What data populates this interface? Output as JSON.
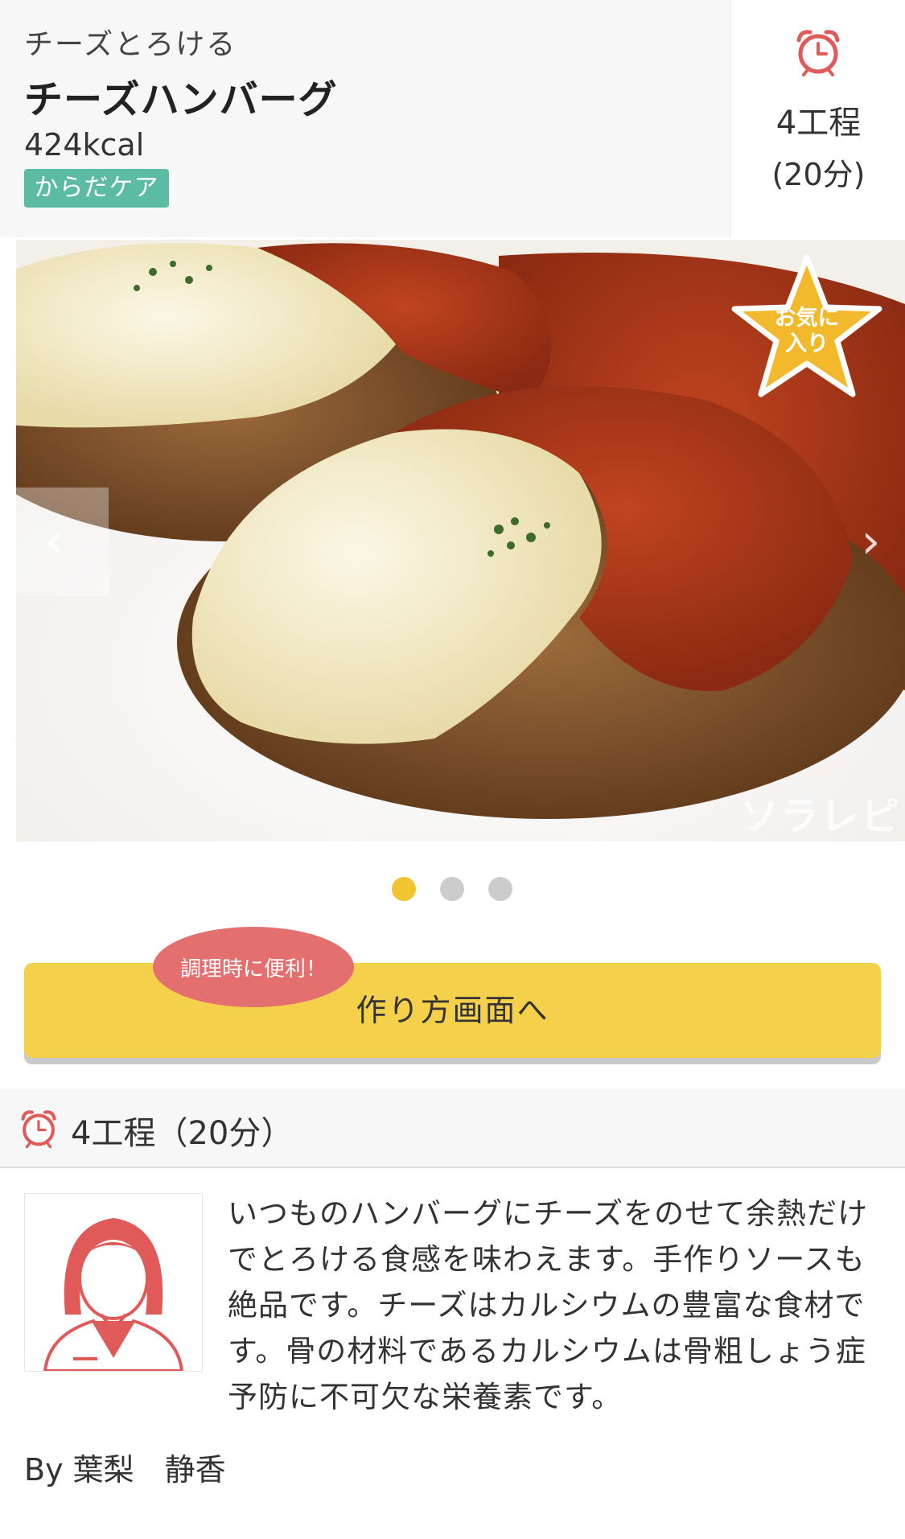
{
  "recipe": {
    "subtitle": "チーズとろける",
    "title": "チーズハンバーグ",
    "kcal": "424kcal",
    "tag": "からだケア",
    "tag_color": "#5bbba3"
  },
  "side_panel": {
    "icon": "alarm-clock-icon",
    "steps": "4工程",
    "minutes": "(20分)"
  },
  "photo": {
    "favorite_badge": "お気に\n入り",
    "watermark": "ソラレピ",
    "prev_icon": "chevron-left-icon",
    "next_icon": "chevron-right-icon"
  },
  "carousel": {
    "total": 3,
    "active_index": 0
  },
  "cta": {
    "label": "作り方画面へ",
    "bubble": "調理時に便利！",
    "color": "#f5d04a",
    "bubble_color": "#e36f6f"
  },
  "steps_bar": {
    "icon": "alarm-clock-icon",
    "label": "4工程（20分）"
  },
  "author": {
    "avatar_icon": "nutritionist-avatar-icon",
    "description": "いつものハンバーグにチーズをのせて余熱だけでとろける食感を味わえます。手作りソースも絶品です。チーズはカルシウムの豊富な食材です。骨の材料であるカルシウムは骨粗しょう症予防に不可欠な栄養素です。",
    "byline": "By 葉梨　静香"
  }
}
